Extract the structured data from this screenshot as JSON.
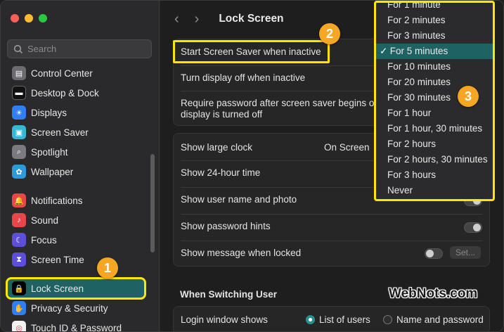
{
  "window": {
    "title": "Lock Screen"
  },
  "colors": {
    "accent": "#1f6264",
    "highlight": "#ffe600",
    "badge": "#f5a623"
  },
  "search": {
    "placeholder": "Search"
  },
  "sidebar": {
    "items": [
      {
        "label": "Control Center",
        "icon": "control-center-icon"
      },
      {
        "label": "Desktop & Dock",
        "icon": "dock-icon"
      },
      {
        "label": "Displays",
        "icon": "sun-icon"
      },
      {
        "label": "Screen Saver",
        "icon": "screen-saver-icon"
      },
      {
        "label": "Spotlight",
        "icon": "magnifier-icon"
      },
      {
        "label": "Wallpaper",
        "icon": "flower-icon"
      },
      {
        "label": "Notifications",
        "icon": "bell-icon"
      },
      {
        "label": "Sound",
        "icon": "speaker-icon"
      },
      {
        "label": "Focus",
        "icon": "moon-icon"
      },
      {
        "label": "Screen Time",
        "icon": "hourglass-icon"
      },
      {
        "label": "Lock Screen",
        "icon": "lock-icon"
      },
      {
        "label": "Privacy & Security",
        "icon": "hand-icon"
      },
      {
        "label": "Touch ID & Password",
        "icon": "fingerprint-icon"
      }
    ]
  },
  "main": {
    "rows": {
      "start_screen_saver": "Start Screen Saver when inactive",
      "display_off": "Turn display off when inactive",
      "require_password_line1": "Require password after screen saver begins or",
      "require_password_line2": "display is turned off",
      "show_large_clock": "Show large clock",
      "large_clock_value": "On Screen",
      "show_24_hour": "Show 24-hour time",
      "show_user_name": "Show user name and photo",
      "show_password_hints": "Show password hints",
      "show_message": "Show message when locked",
      "set_button": "Set...",
      "section_switching": "When Switching User",
      "login_window_shows": "Login window shows",
      "option_list": "List of users",
      "option_name_password": "Name and password"
    }
  },
  "dropdown": {
    "selected": "For 5 minutes",
    "options": [
      "For 1 minute",
      "For 2 minutes",
      "For 3 minutes",
      "For 5 minutes",
      "For 10 minutes",
      "For 20 minutes",
      "For 30 minutes",
      "For 1 hour",
      "For 1 hour, 30 minutes",
      "For 2 hours",
      "For 2 hours, 30 minutes",
      "For 3 hours",
      "Never"
    ],
    "check": "✓"
  },
  "badges": {
    "b1": "1",
    "b2": "2",
    "b3": "3"
  },
  "watermark": "WebNots.com"
}
